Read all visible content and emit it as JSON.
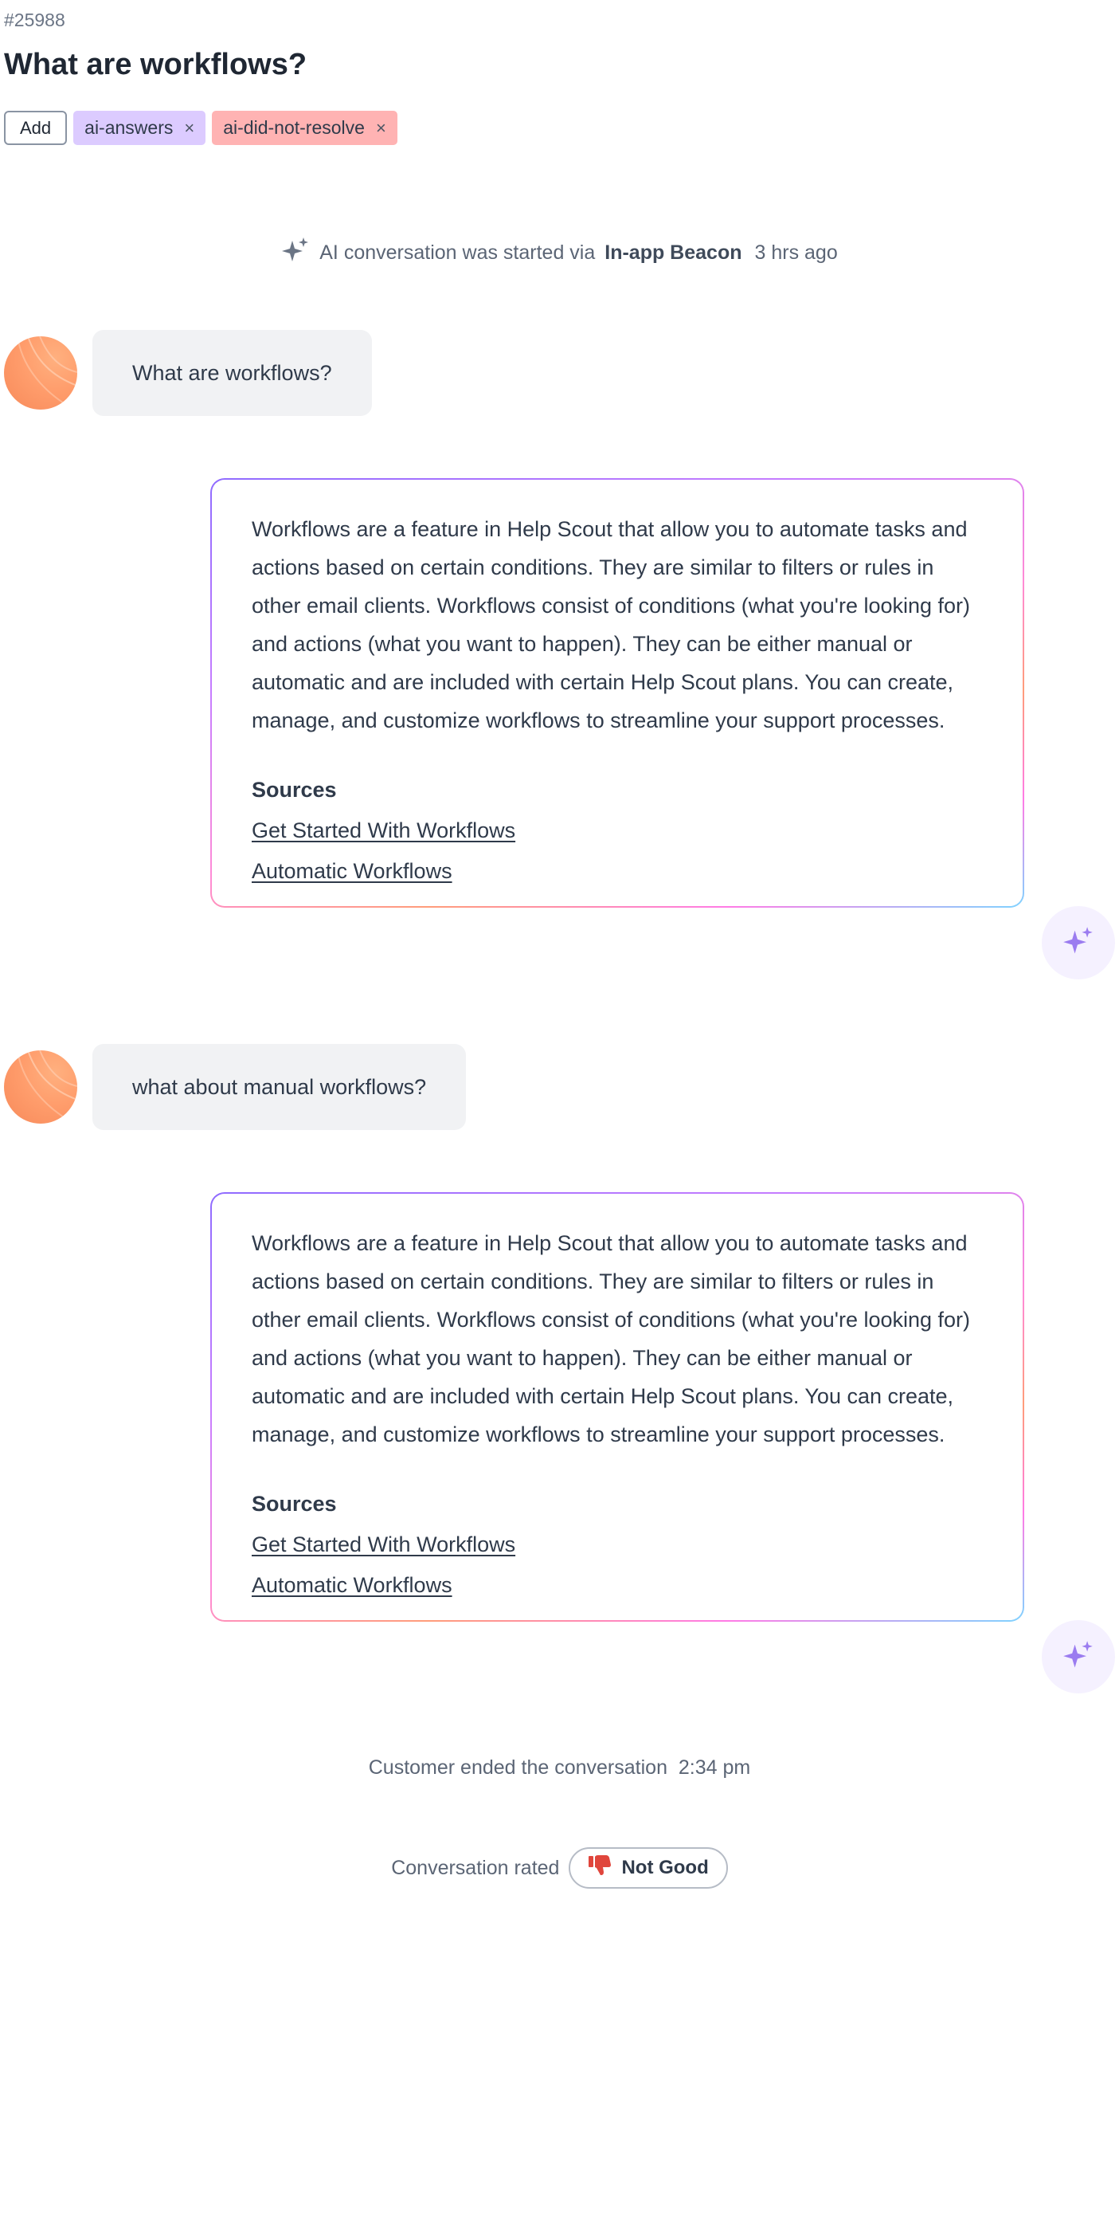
{
  "header": {
    "ticket_id": "#25988",
    "title": "What are workflows?"
  },
  "tags": {
    "add_label": "Add",
    "items": [
      {
        "label": "ai-answers",
        "color": "#dccbff"
      },
      {
        "label": "ai-did-not-resolve",
        "color": "#ffb3b3"
      }
    ],
    "remove_glyph": "×"
  },
  "start_event": {
    "text": "AI conversation was started via",
    "channel": "In-app Beacon",
    "time": "3 hrs ago",
    "icon": "sparkle-icon"
  },
  "messages": [
    {
      "customer": "What are workflows?",
      "ai": {
        "text": "Workflows are a feature in Help Scout that allow you to automate tasks and actions based on certain conditions. They are similar to filters or rules in other email clients. Workflows consist of conditions (what you're looking for) and actions (what you want to happen). They can be either manual or automatic and are included with certain Help Scout plans. You can create, manage, and customize workflows to streamline your support processes.",
        "sources_title": "Sources",
        "sources": [
          "Get Started With Workflows",
          "Automatic Workflows"
        ]
      }
    },
    {
      "customer": "what about manual workflows?",
      "ai": {
        "text": "Workflows are a feature in Help Scout that allow you to automate tasks and actions based on certain conditions. They are similar to filters or rules in other email clients. Workflows consist of conditions (what you're looking for) and actions (what you want to happen). They can be either manual or automatic and are included with certain Help Scout plans. You can create, manage, and customize workflows to streamline your support processes.",
        "sources_title": "Sources",
        "sources": [
          "Get Started With Workflows",
          "Automatic Workflows"
        ]
      }
    }
  ],
  "end_event": {
    "text": "Customer ended the conversation",
    "time": "2:34 pm"
  },
  "rating": {
    "label": "Conversation rated",
    "value": "Not Good",
    "icon": "thumbs-down-icon",
    "icon_color": "#e0463c"
  },
  "colors": {
    "accent_purple": "#8f6bff",
    "sparkle": "#9b7cf0"
  }
}
